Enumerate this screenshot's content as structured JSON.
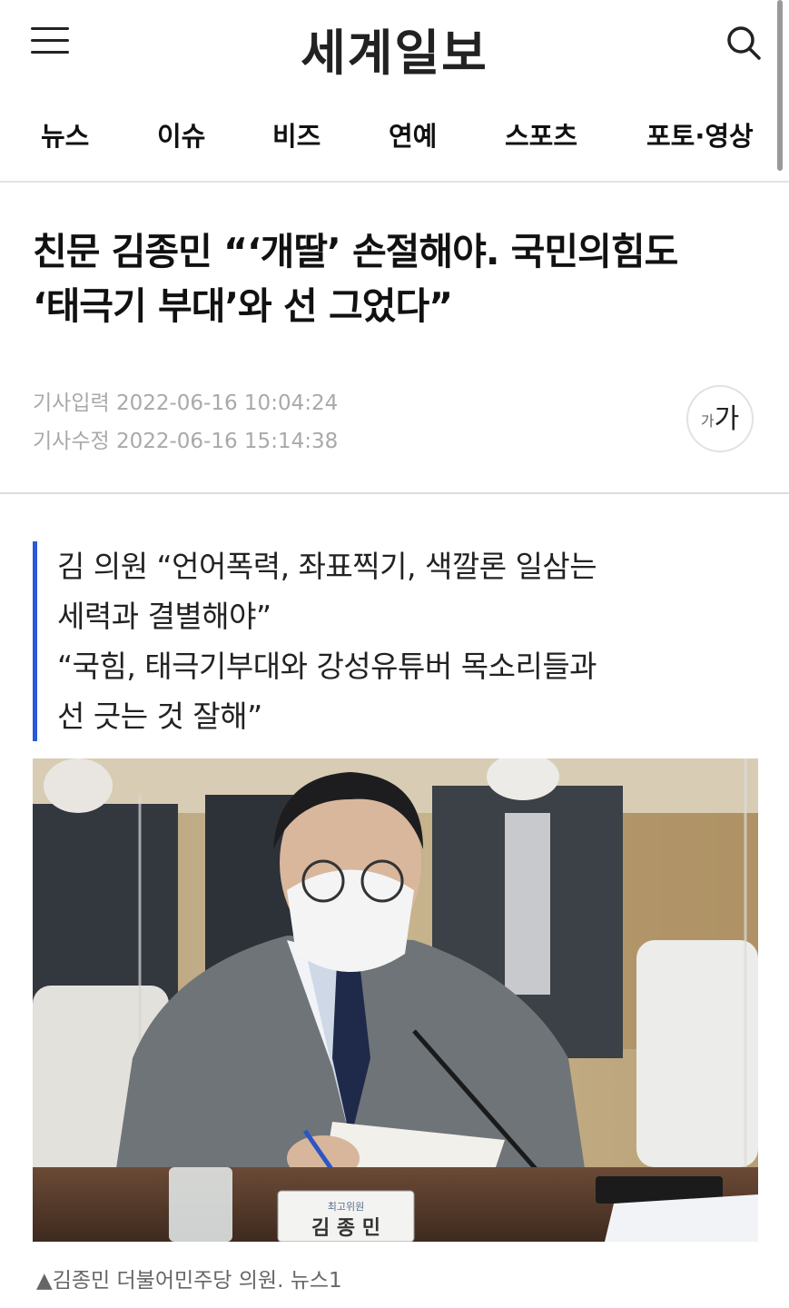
{
  "header": {
    "logo": "세계일보",
    "menu_icon": "hamburger-menu-icon",
    "search_icon": "search-icon"
  },
  "nav": {
    "items": [
      {
        "label": "뉴스"
      },
      {
        "label": "이슈"
      },
      {
        "label": "비즈"
      },
      {
        "label": "연예"
      },
      {
        "label": "스포츠"
      },
      {
        "label": "포토·영상"
      }
    ]
  },
  "article": {
    "headline_line1": "친문 김종민 “‘개딸’ 손절해야. 국민의힘도",
    "headline_line2": "‘태극기 부대’와 선 그었다”",
    "published": "기사입력 2022-06-16 10:04:24",
    "modified": "기사수정 2022-06-16 15:14:38",
    "font_size_small": "가",
    "font_size_large": "가",
    "summary_lines": [
      "김 의원 “언어폭력, 좌표찍기, 색깔론 일삼는",
      "세력과 결별해야”",
      "“국힘, 태극기부대와 강성유튜버 목소리들과",
      "선 긋는 것 잘해”"
    ],
    "nameplate_title": "최고위원",
    "nameplate_name": "김 종 민",
    "caption": "김종민 더불어민주당 의원. 뉴스1",
    "caption_icon": "triangle-up-icon"
  },
  "colors": {
    "accent": "#2a5bd7",
    "meta_text": "#a9a9a9"
  }
}
